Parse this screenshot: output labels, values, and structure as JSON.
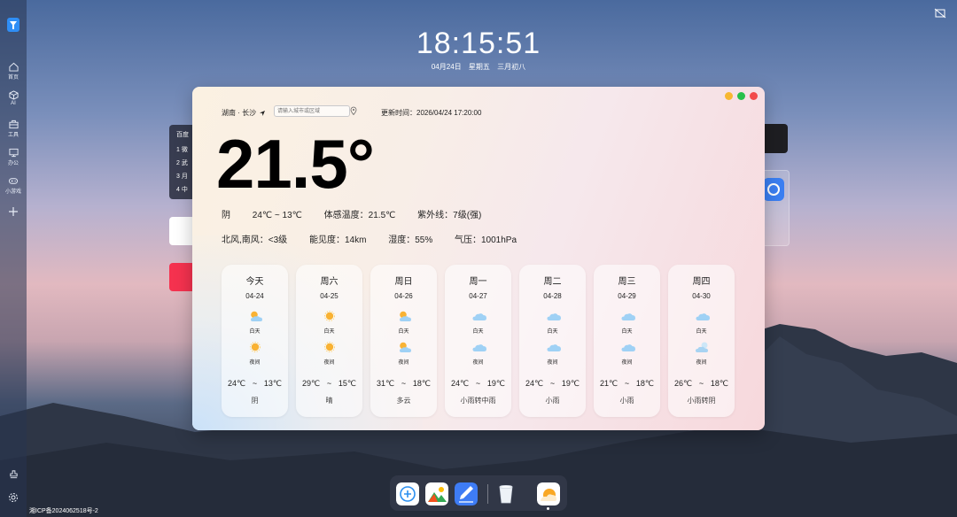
{
  "clock": {
    "time": "18:15:51",
    "date": "04月24日",
    "weekday": "星期五",
    "lunar": "三月初八"
  },
  "sidebar": {
    "items": [
      {
        "label": "首页",
        "icon": "home-icon"
      },
      {
        "label": "AI",
        "icon": "cube-icon"
      },
      {
        "label": "工具",
        "icon": "toolbox-icon"
      },
      {
        "label": "办公",
        "icon": "monitor-icon"
      },
      {
        "label": "小游戏",
        "icon": "gamepad-icon"
      }
    ],
    "add_icon": "plus-icon",
    "bottom_icons": [
      "stamp-icon",
      "gear-icon"
    ]
  },
  "hot_list": {
    "title": "百度",
    "rows": [
      "1 微",
      "2 武",
      "3 月",
      "4 中"
    ]
  },
  "weather": {
    "location": "湖南 · 长沙",
    "city_placeholder": "请输入城市或区域",
    "update_time": "更新时间：2026/04/24 17:20:00",
    "temperature": "21.5°",
    "condition": "阴",
    "range": "24℃ ~ 13℃",
    "feels_like": "体感温度：21.5℃",
    "uv": "紫外线：7级(强)",
    "wind": "北风,南风：<3级",
    "visibility": "能见度：14km",
    "humidity": "湿度：55%",
    "pressure": "气压：1001hPa",
    "day_label": "白天",
    "night_label": "夜间",
    "tilde": "~",
    "forecast": [
      {
        "name": "今天",
        "date": "04-24",
        "day_icon": "partly-cloudy-icon",
        "night_icon": "sun-icon",
        "high": "24℃",
        "low": "13℃",
        "desc": "阴"
      },
      {
        "name": "周六",
        "date": "04-25",
        "day_icon": "sun-icon",
        "night_icon": "sun-icon",
        "high": "29℃",
        "low": "15℃",
        "desc": "晴"
      },
      {
        "name": "周日",
        "date": "04-26",
        "day_icon": "partly-cloudy-icon",
        "night_icon": "partly-cloudy-icon",
        "high": "31℃",
        "low": "18℃",
        "desc": "多云"
      },
      {
        "name": "周一",
        "date": "04-27",
        "day_icon": "cloud-icon",
        "night_icon": "cloud-icon",
        "high": "24℃",
        "low": "19℃",
        "desc": "小雨转中雨"
      },
      {
        "name": "周二",
        "date": "04-28",
        "day_icon": "cloud-icon",
        "night_icon": "cloud-icon",
        "high": "24℃",
        "low": "19℃",
        "desc": "小雨"
      },
      {
        "name": "周三",
        "date": "04-29",
        "day_icon": "cloud-icon",
        "night_icon": "cloud-icon",
        "high": "21℃",
        "low": "18℃",
        "desc": "小雨"
      },
      {
        "name": "周四",
        "date": "04-30",
        "day_icon": "cloud-icon",
        "night_icon": "cloud-sun-icon",
        "high": "26℃",
        "low": "18℃",
        "desc": "小雨转阴"
      }
    ]
  },
  "window_controls": {
    "minimize": "#f7b731",
    "maximize": "#26c04a",
    "close": "#f24b4b"
  },
  "dock": {
    "items": [
      "add-app-icon",
      "photos-icon",
      "notes-icon",
      "trash-icon",
      "weather-app-icon"
    ]
  },
  "footer": {
    "icp": "湘ICP备2024062518号-2"
  }
}
